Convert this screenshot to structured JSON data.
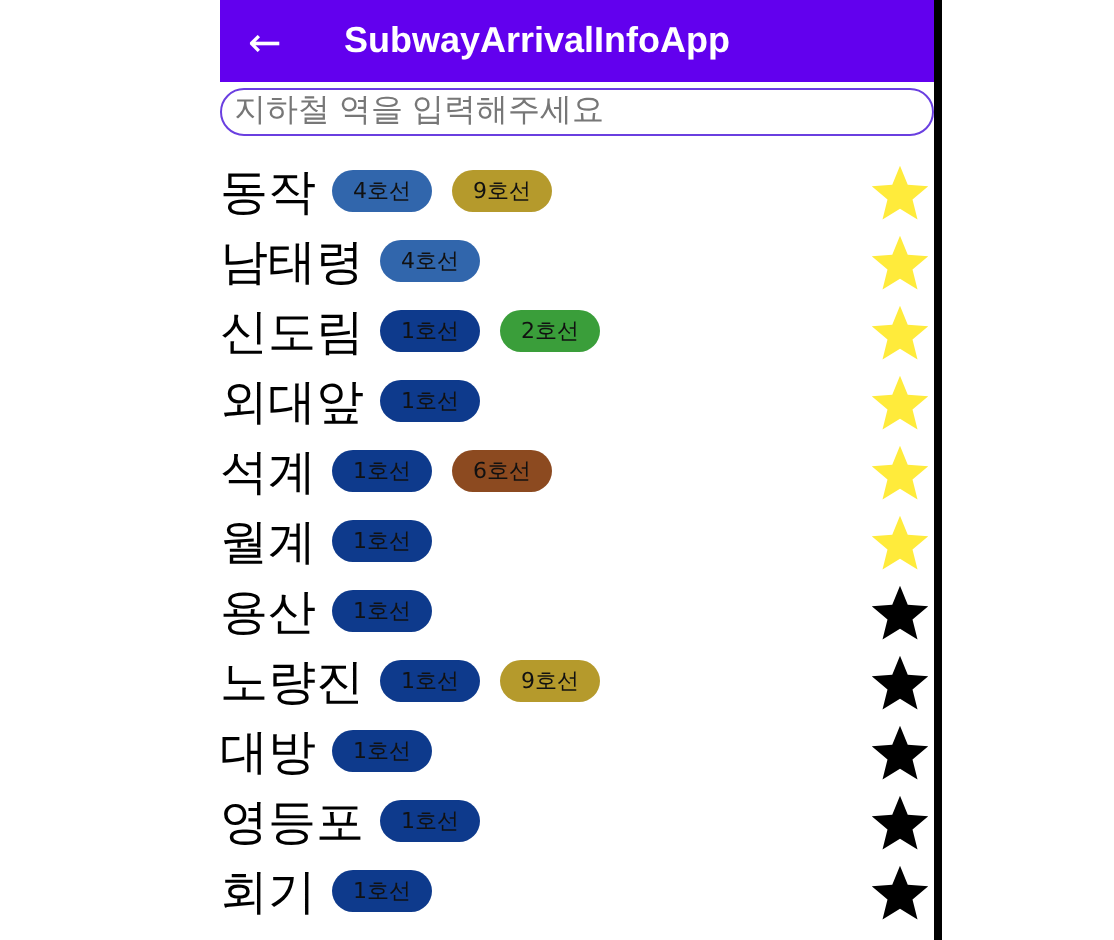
{
  "app_bar": {
    "back_icon": "←",
    "title": "SubwayArrivalInfoApp"
  },
  "search": {
    "placeholder": "지하철 역을 입력해주세요"
  },
  "stations": [
    {
      "name": "동작",
      "favorite": true,
      "lines": [
        {
          "label": "4호선",
          "color": "#3166ac"
        },
        {
          "label": "9호선",
          "color": "#b59a2c"
        }
      ]
    },
    {
      "name": "남태령",
      "favorite": true,
      "lines": [
        {
          "label": "4호선",
          "color": "#3166ac"
        }
      ]
    },
    {
      "name": "신도림",
      "favorite": true,
      "lines": [
        {
          "label": "1호선",
          "color": "#0e3a8c"
        },
        {
          "label": "2호선",
          "color": "#3a9e3a"
        }
      ]
    },
    {
      "name": "외대앞",
      "favorite": true,
      "lines": [
        {
          "label": "1호선",
          "color": "#0e3a8c"
        }
      ]
    },
    {
      "name": "석계",
      "favorite": true,
      "lines": [
        {
          "label": "1호선",
          "color": "#0e3a8c"
        },
        {
          "label": "6호선",
          "color": "#8c4a20"
        }
      ]
    },
    {
      "name": "월계",
      "favorite": true,
      "lines": [
        {
          "label": "1호선",
          "color": "#0e3a8c"
        }
      ]
    },
    {
      "name": "용산",
      "favorite": false,
      "lines": [
        {
          "label": "1호선",
          "color": "#0e3a8c"
        }
      ]
    },
    {
      "name": "노량진",
      "favorite": false,
      "lines": [
        {
          "label": "1호선",
          "color": "#0e3a8c"
        },
        {
          "label": "9호선",
          "color": "#b59a2c"
        }
      ]
    },
    {
      "name": "대방",
      "favorite": false,
      "lines": [
        {
          "label": "1호선",
          "color": "#0e3a8c"
        }
      ]
    },
    {
      "name": "영등포",
      "favorite": false,
      "lines": [
        {
          "label": "1호선",
          "color": "#0e3a8c"
        }
      ]
    },
    {
      "name": "회기",
      "favorite": false,
      "lines": [
        {
          "label": "1호선",
          "color": "#0e3a8c"
        }
      ]
    }
  ]
}
